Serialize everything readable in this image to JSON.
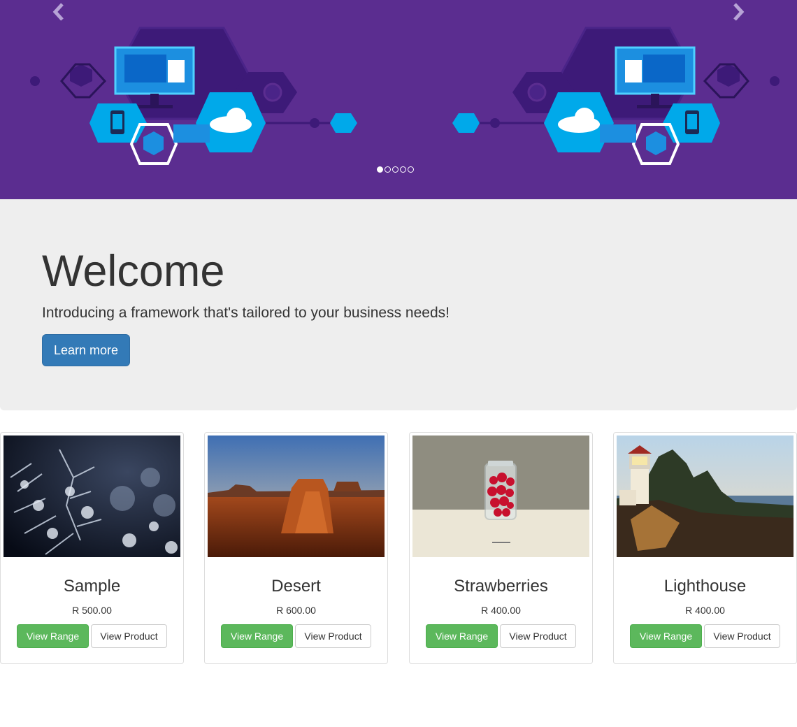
{
  "carousel": {
    "prev_icon": "chevron-left-icon",
    "next_icon": "chevron-right-icon",
    "slide_count": 5,
    "active_slide": 1,
    "background": "#5b2d90"
  },
  "jumbotron": {
    "heading": "Welcome",
    "lead": "Introducing a framework that's tailored to your business needs!",
    "button_label": "Learn more"
  },
  "products": [
    {
      "title": "Sample",
      "price": "R 500.00",
      "range_label": "View Range",
      "product_label": "View Product"
    },
    {
      "title": "Desert",
      "price": "R 600.00",
      "range_label": "View Range",
      "product_label": "View Product"
    },
    {
      "title": "Strawberries",
      "price": "R 400.00",
      "range_label": "View Range",
      "product_label": "View Product"
    },
    {
      "title": "Lighthouse",
      "price": "R 400.00",
      "range_label": "View Range",
      "product_label": "View Product"
    }
  ],
  "colors": {
    "primary": "#337ab7",
    "success": "#5cb85c",
    "jumbotron_bg": "#eeeeee"
  }
}
